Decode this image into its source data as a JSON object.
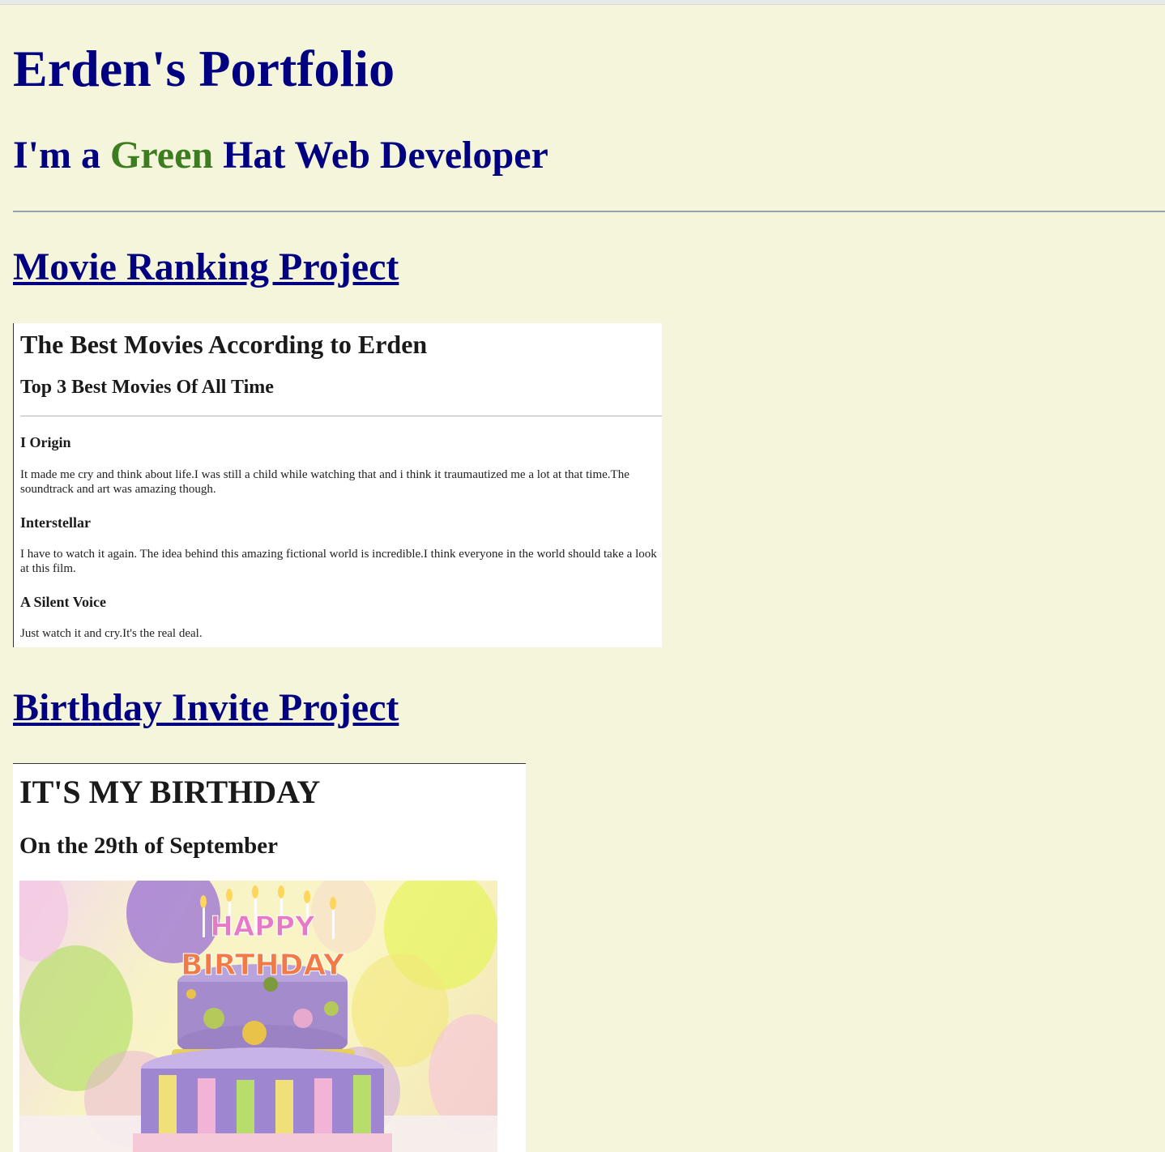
{
  "header": {
    "title": "Erden's Portfolio",
    "subtitle_pre": "I'm a ",
    "subtitle_accent": "Green",
    "subtitle_post": " Hat Web Developer"
  },
  "colors": {
    "background": "#f5f5dc",
    "heading": "#000080",
    "accent_green": "#3b7d1f"
  },
  "projects": [
    {
      "link_label": "Movie Ranking Project",
      "preview": {
        "title": "The Best Movies According to Erden",
        "subtitle": "Top 3 Best Movies Of All Time",
        "movies": [
          {
            "name": "I Origin",
            "review": "It made me cry and think about life.I was still a child while watching that and i think it traumautized me a lot at that time.The soundtrack and art was amazing though."
          },
          {
            "name": "Interstellar",
            "review": "I have to watch it again. The idea behind this amazing fictional world is incredible.I think everyone in the world should take a look at this film."
          },
          {
            "name": "A Silent Voice",
            "review": "Just watch it and cry.It's the real deal."
          }
        ]
      }
    },
    {
      "link_label": "Birthday Invite Project",
      "preview": {
        "title": "IT'S MY BIRTHDAY",
        "subtitle": "On the 29th of September",
        "image": {
          "icon": "birthday-cake-image",
          "cake_lettering_top": "HAPPY",
          "cake_lettering_bottom": "BIRTHDAY"
        }
      }
    }
  ]
}
